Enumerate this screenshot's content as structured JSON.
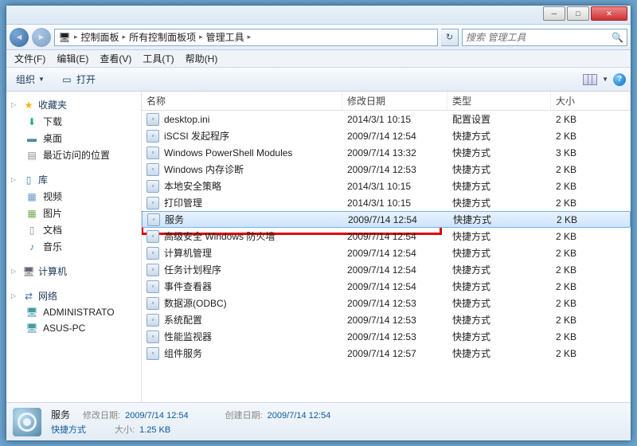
{
  "window": {
    "min": "─",
    "max": "□",
    "close": "✕"
  },
  "breadcrumb": {
    "root_icon": "🖥",
    "p1": "控制面板",
    "p2": "所有控制面板项",
    "p3": "管理工具",
    "sep": "▸",
    "refresh": "↻"
  },
  "search": {
    "placeholder": "搜索 管理工具",
    "icon": "🔍"
  },
  "menu": {
    "file": "文件(F)",
    "edit": "编辑(E)",
    "view": "查看(V)",
    "tools": "工具(T)",
    "help": "帮助(H)"
  },
  "toolbar": {
    "organize": "组织",
    "open": "打开",
    "views": "▥",
    "help": "?"
  },
  "sidebar": {
    "favorites": {
      "label": "收藏夹",
      "items": [
        "下载",
        "桌面",
        "最近访问的位置"
      ]
    },
    "libraries": {
      "label": "库",
      "items": [
        "视频",
        "图片",
        "文档",
        "音乐"
      ]
    },
    "computer": {
      "label": "计算机"
    },
    "network": {
      "label": "网络",
      "items": [
        "ADMINISTRATO",
        "ASUS-PC"
      ]
    }
  },
  "columns": {
    "name": "名称",
    "date": "修改日期",
    "type": "类型",
    "size": "大小"
  },
  "files": [
    {
      "name": "desktop.ini",
      "date": "2014/3/1 10:15",
      "type": "配置设置",
      "size": "2 KB"
    },
    {
      "name": "iSCSI 发起程序",
      "date": "2009/7/14 12:54",
      "type": "快捷方式",
      "size": "2 KB"
    },
    {
      "name": "Windows PowerShell Modules",
      "date": "2009/7/14 13:32",
      "type": "快捷方式",
      "size": "3 KB"
    },
    {
      "name": "Windows 内存诊断",
      "date": "2009/7/14 12:53",
      "type": "快捷方式",
      "size": "2 KB"
    },
    {
      "name": "本地安全策略",
      "date": "2014/3/1 10:15",
      "type": "快捷方式",
      "size": "2 KB"
    },
    {
      "name": "打印管理",
      "date": "2014/3/1 10:15",
      "type": "快捷方式",
      "size": "2 KB"
    },
    {
      "name": "服务",
      "date": "2009/7/14 12:54",
      "type": "快捷方式",
      "size": "2 KB",
      "selected": true
    },
    {
      "name": "高级安全 Windows 防火墙",
      "date": "2009/7/14 12:54",
      "type": "快捷方式",
      "size": "2 KB"
    },
    {
      "name": "计算机管理",
      "date": "2009/7/14 12:54",
      "type": "快捷方式",
      "size": "2 KB"
    },
    {
      "name": "任务计划程序",
      "date": "2009/7/14 12:54",
      "type": "快捷方式",
      "size": "2 KB"
    },
    {
      "name": "事件查看器",
      "date": "2009/7/14 12:54",
      "type": "快捷方式",
      "size": "2 KB"
    },
    {
      "name": "数据源(ODBC)",
      "date": "2009/7/14 12:53",
      "type": "快捷方式",
      "size": "2 KB"
    },
    {
      "name": "系统配置",
      "date": "2009/7/14 12:53",
      "type": "快捷方式",
      "size": "2 KB"
    },
    {
      "name": "性能监视器",
      "date": "2009/7/14 12:53",
      "type": "快捷方式",
      "size": "2 KB"
    },
    {
      "name": "组件服务",
      "date": "2009/7/14 12:57",
      "type": "快捷方式",
      "size": "2 KB"
    }
  ],
  "status": {
    "title": "服务",
    "mod_label": "修改日期:",
    "mod_val": "2009/7/14 12:54",
    "create_label": "创建日期:",
    "create_val": "2009/7/14 12:54",
    "type_val": "快捷方式",
    "size_label": "大小:",
    "size_val": "1.25 KB"
  }
}
